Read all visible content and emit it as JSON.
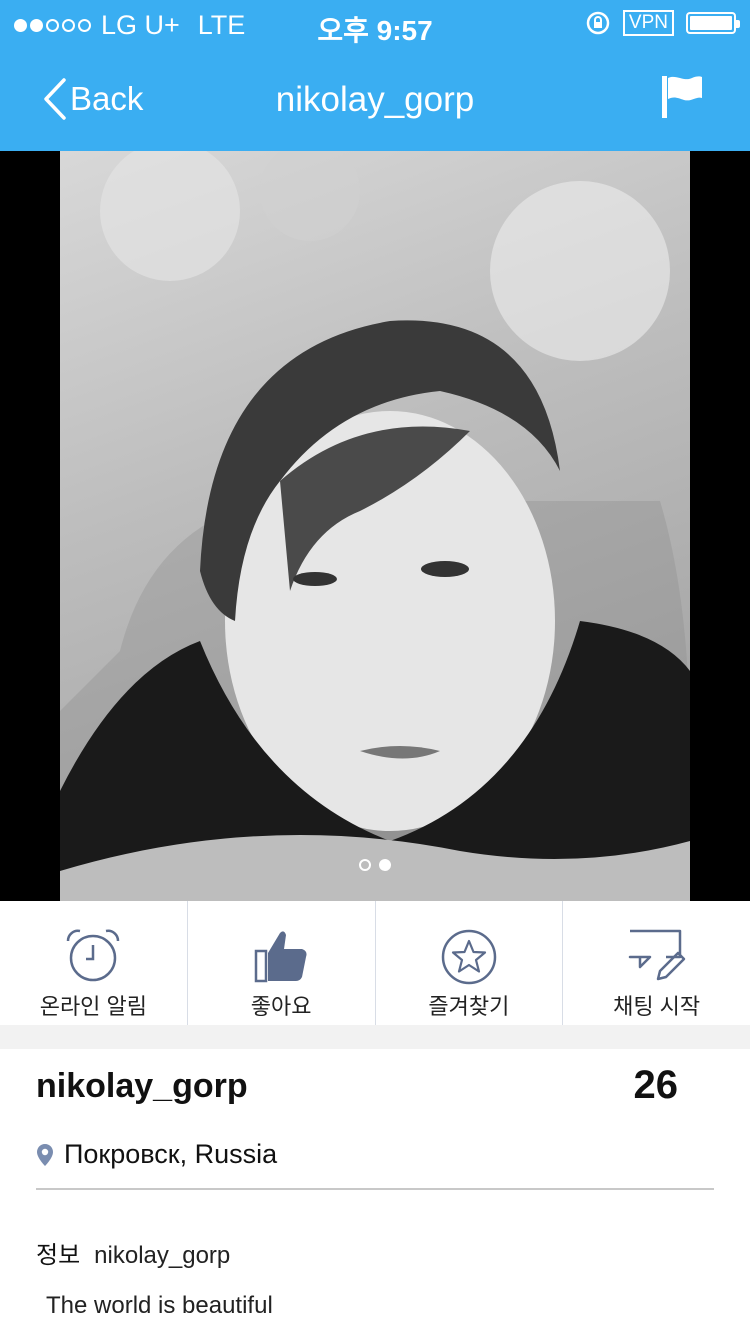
{
  "status_bar": {
    "carrier": "LG U+",
    "network": "LTE",
    "time": "오후 9:57",
    "vpn": "VPN",
    "signal_dots_filled": 2,
    "signal_dots_total": 5
  },
  "nav": {
    "back_label": "Back",
    "title": "nikolay_gorp",
    "report_icon": "flag-icon"
  },
  "photo": {
    "pages_total": 2,
    "current_page": 2
  },
  "actions": [
    {
      "icon": "alarm-clock-icon",
      "label": "온라인 알림"
    },
    {
      "icon": "thumbs-up-icon",
      "label": "좋아요"
    },
    {
      "icon": "star-icon",
      "label": "즐겨찾기"
    },
    {
      "icon": "chat-pencil-icon",
      "label": "채팅 시작"
    }
  ],
  "profile": {
    "name": "nikolay_gorp",
    "age": "26",
    "location": "Покровск, Russia",
    "about_label": "정보",
    "about_value": "nikolay_gorp",
    "bio": "The world is beautiful"
  },
  "colors": {
    "accent": "#3aaef2",
    "icon": "#5b6b8c",
    "divider": "#c8c8c8"
  }
}
